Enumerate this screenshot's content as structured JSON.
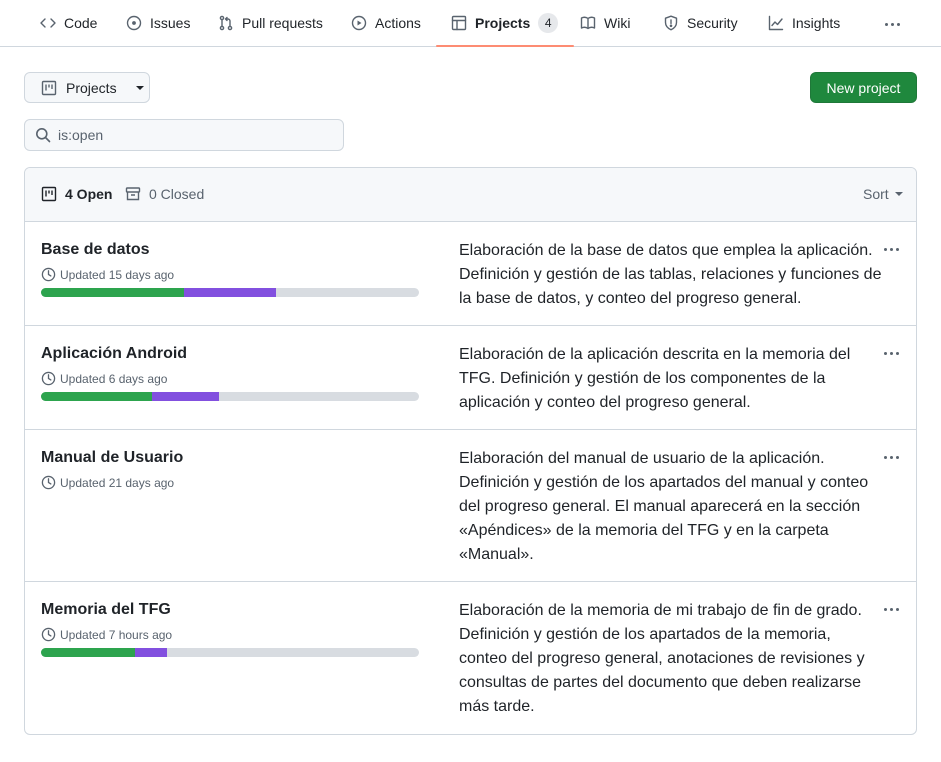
{
  "nav": {
    "tabs": [
      {
        "label": "Code",
        "icon": "code-icon"
      },
      {
        "label": "Issues",
        "icon": "issue-opened-icon"
      },
      {
        "label": "Pull requests",
        "icon": "git-pull-request-icon"
      },
      {
        "label": "Actions",
        "icon": "play-icon"
      },
      {
        "label": "Projects",
        "icon": "table-icon",
        "counter": "4",
        "selected": true
      },
      {
        "label": "Wiki",
        "icon": "book-icon"
      },
      {
        "label": "Security",
        "icon": "shield-icon"
      },
      {
        "label": "Insights",
        "icon": "graph-icon"
      }
    ]
  },
  "toolbar": {
    "projects_dropdown_label": "Projects",
    "new_project_label": "New project"
  },
  "search": {
    "value": "is:open"
  },
  "list_header": {
    "open_label": "4 Open",
    "closed_label": "0 Closed",
    "sort_label": "Sort"
  },
  "colors": {
    "accent_selected_tab": "#fd8c73",
    "primary_button": "#1f883d",
    "progress_done": "#2da44e",
    "progress_in_progress": "#8250df",
    "progress_todo": "#d8dce1"
  },
  "projects": [
    {
      "title": "Base de datos",
      "updated": "Updated 15 days ago",
      "progress": {
        "done_fraction": 0.377,
        "in_progress_fraction": 0.246
      },
      "description": "Elaboración de la base de datos que emplea la aplicación. Definición y gestión de las tablas, relaciones y funciones de la base de datos, y conteo del progreso general."
    },
    {
      "title": "Aplicación Android",
      "updated": "Updated 6 days ago",
      "progress": {
        "done_fraction": 0.294,
        "in_progress_fraction": 0.177
      },
      "description": "Elaboración de la aplicación descrita en la memoria del TFG. Definición y gestión de los componentes de la aplicación y conteo del progreso general."
    },
    {
      "title": "Manual de Usuario",
      "updated": "Updated 21 days ago",
      "progress": null,
      "description": "Elaboración del manual de usuario de la aplicación. Definición y gestión de los apartados del manual y conteo del progreso general. El manual aparecerá en la sección «Apéndices» de la memoria del TFG y en la carpeta «Manual»."
    },
    {
      "title": "Memoria del TFG",
      "updated": "Updated 7 hours ago",
      "progress": {
        "done_fraction": 0.249,
        "in_progress_fraction": 0.084
      },
      "description": "Elaboración de la memoria de mi trabajo de fin de grado. Definición y gestión de los apartados de la memoria, conteo del progreso general, anotaciones de revisiones y consultas de partes del documento que deben realizarse más tarde."
    }
  ]
}
